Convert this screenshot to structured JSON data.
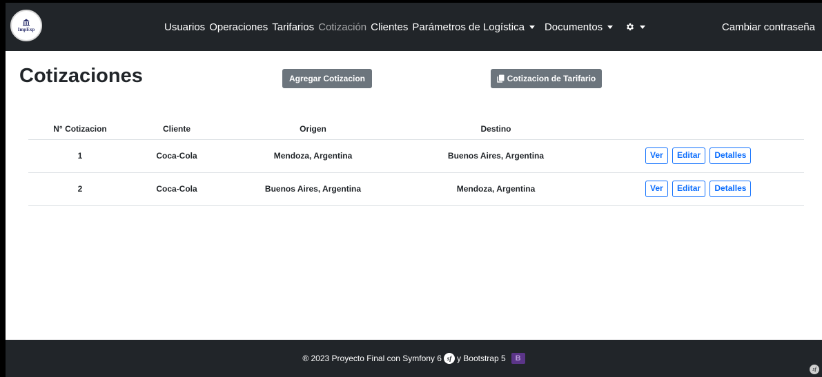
{
  "brand": {
    "logo_text": "ImpExp"
  },
  "nav": {
    "items": [
      {
        "label": "Usuarios"
      },
      {
        "label": "Operaciones"
      },
      {
        "label": "Tarifarios"
      },
      {
        "label": "Cotización"
      },
      {
        "label": "Clientes"
      },
      {
        "label": "Parámetros de Logística"
      },
      {
        "label": "Documentos"
      }
    ],
    "active": "Cotización",
    "right_link": "Cambiar contraseña",
    "settings_icon": "gear-icon"
  },
  "page": {
    "title": "Cotizaciones",
    "add_button": "Agregar Cotizacion",
    "tarifario_button": "Cotizacion de Tarifario",
    "tarifario_icon": "copy-icon"
  },
  "table": {
    "headers": [
      "N° Cotizacion",
      "Cliente",
      "Origen",
      "Destino",
      ""
    ],
    "rows": [
      {
        "id": "1",
        "cliente": "Coca-Cola",
        "origen": "Mendoza, Argentina",
        "destino": "Buenos Aires, Argentina"
      },
      {
        "id": "2",
        "cliente": "Coca-Cola",
        "origen": "Buenos Aires, Argentina",
        "destino": "Mendoza, Argentina"
      }
    ],
    "actions": {
      "ver": "Ver",
      "editar": "Editar",
      "detalles": "Detalles"
    }
  },
  "footer": {
    "text_before": "® 2023 Proyecto Final con Symfony 6",
    "text_middle": "y Bootstrap 5",
    "symfony_icon": "symfony-icon",
    "bootstrap_icon": "bootstrap-icon"
  },
  "colors": {
    "navbar": "#212529",
    "secondary": "#6c757d",
    "primary": "#0d6efd",
    "bootstrap_purple": "#5b3588"
  }
}
